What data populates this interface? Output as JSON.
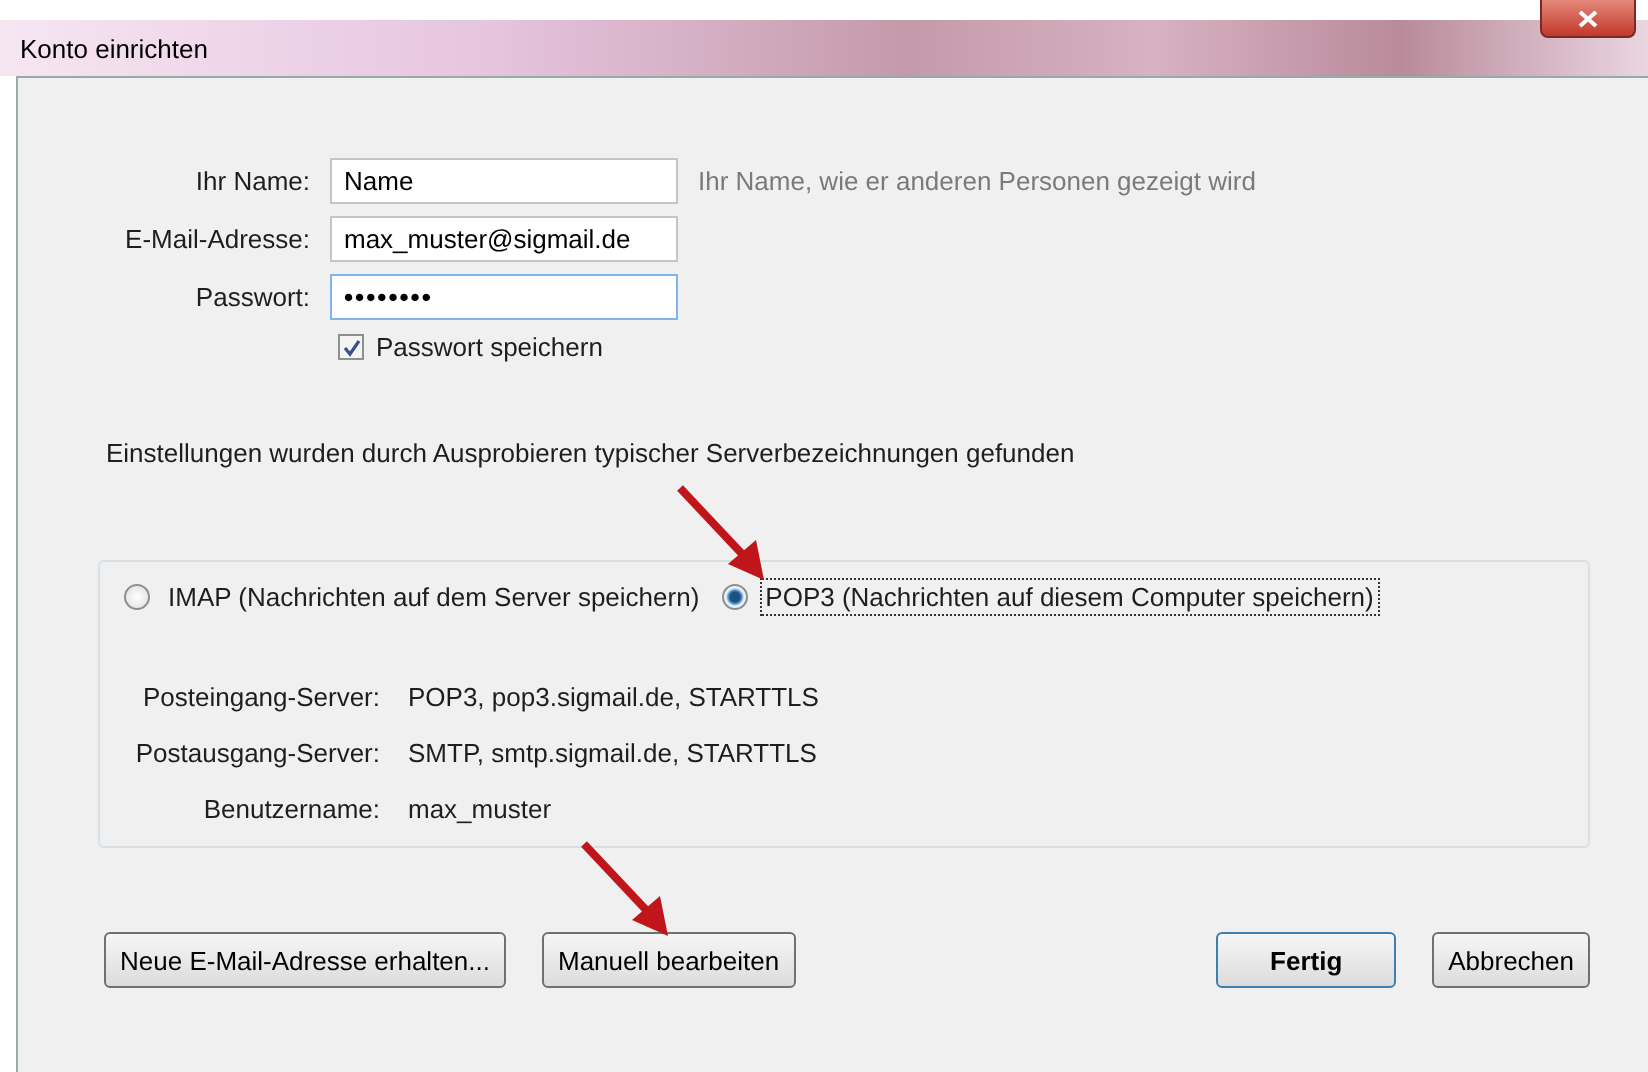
{
  "window": {
    "title": "Konto einrichten"
  },
  "fields": [
    {
      "label": "Ihr Name:",
      "value": "Name",
      "kind": "text",
      "hint": "Ihr Name, wie er anderen Personen gezeigt wird"
    },
    {
      "label": "E-Mail-Adresse:",
      "value": "max_muster@sigmail.de",
      "kind": "text"
    },
    {
      "label": "Passwort:",
      "value": "••••••••",
      "kind": "password"
    }
  ],
  "remember_password": {
    "label": "Passwort speichern",
    "checked": true
  },
  "status": "Einstellungen wurden durch Ausprobieren typischer Serverbezeichnungen gefunden",
  "protocols": [
    {
      "label": "IMAP (Nachrichten auf dem Server speichern)",
      "selected": false
    },
    {
      "label": "POP3 (Nachrichten auf diesem Computer speichern)",
      "selected": true
    }
  ],
  "servers": [
    {
      "label": "Posteingang-Server:",
      "value": "POP3, pop3.sigmail.de, STARTTLS"
    },
    {
      "label": "Postausgang-Server:",
      "value": "SMTP, smtp.sigmail.de, STARTTLS"
    },
    {
      "label": "Benutzername:",
      "value": "max_muster"
    }
  ],
  "buttons_left": [
    "Neue E-Mail-Adresse erhalten...",
    "Manuell bearbeiten"
  ],
  "buttons_right": [
    {
      "label": "Fertig",
      "default": true
    },
    {
      "label": "Abbrechen",
      "default": false
    }
  ]
}
